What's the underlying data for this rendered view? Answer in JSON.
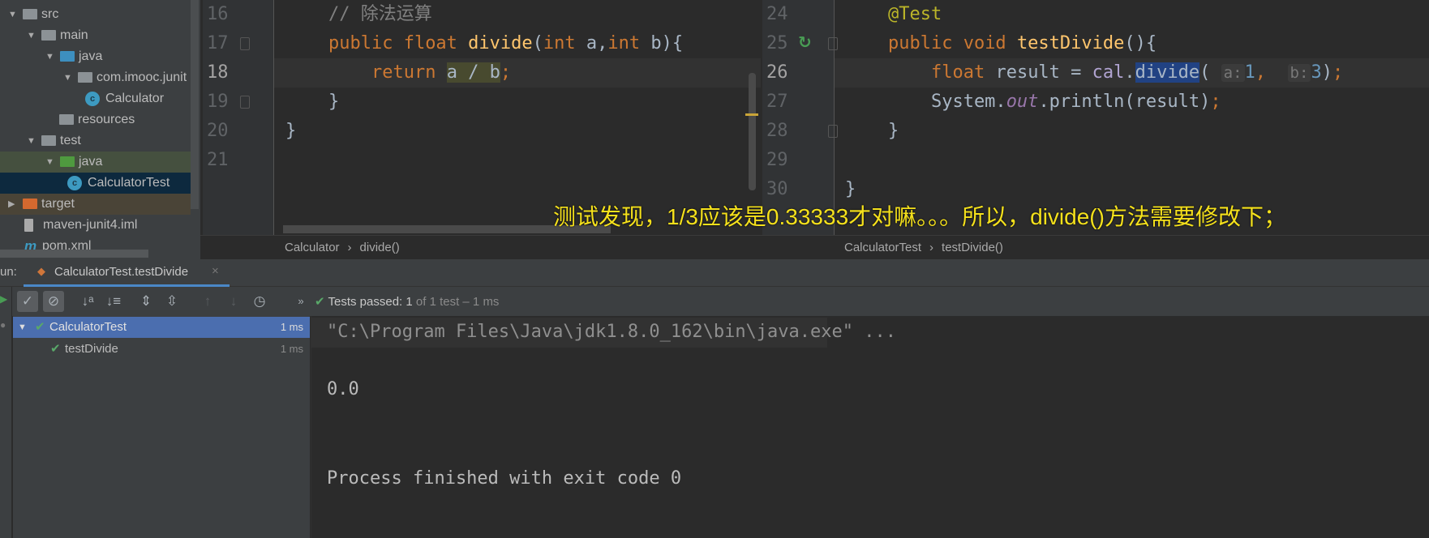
{
  "project_tree": {
    "items": [
      {
        "label": "src",
        "depth": 0,
        "expanded": true,
        "icon": "folder-icon"
      },
      {
        "label": "main",
        "depth": 1,
        "expanded": true,
        "icon": "folder-icon"
      },
      {
        "label": "java",
        "depth": 2,
        "expanded": true,
        "icon": "source-folder-icon"
      },
      {
        "label": "com.imooc.junit",
        "depth": 3,
        "expanded": true,
        "icon": "package-icon"
      },
      {
        "label": "Calculator",
        "depth": 4,
        "icon": "class-icon"
      },
      {
        "label": "resources",
        "depth": 2,
        "icon": "resources-folder-icon"
      },
      {
        "label": "test",
        "depth": 1,
        "expanded": true,
        "icon": "folder-icon"
      },
      {
        "label": "java",
        "depth": 2,
        "expanded": true,
        "icon": "test-folder-icon"
      },
      {
        "label": "CalculatorTest",
        "depth": 3,
        "icon": "test-class-icon",
        "selected": true
      },
      {
        "label": "target",
        "depth": 0,
        "expanded": false,
        "icon": "excluded-folder-icon"
      },
      {
        "label": "maven-junit4.iml",
        "depth": 0,
        "icon": "iml-file-icon"
      },
      {
        "label": "pom.xml",
        "depth": 0,
        "icon": "maven-icon"
      }
    ]
  },
  "left_editor": {
    "line_numbers": [
      "16",
      "17",
      "18",
      "19",
      "20",
      "21"
    ],
    "current_line": "18",
    "lines": [
      [
        {
          "c": "",
          "t": "    "
        },
        {
          "c": "cm",
          "t": "// 除法运算"
        }
      ],
      [
        {
          "c": "",
          "t": "    "
        },
        {
          "c": "kw",
          "t": "public float "
        },
        {
          "c": "fn",
          "t": "divide"
        },
        {
          "c": "",
          "t": "("
        },
        {
          "c": "kw",
          "t": "int "
        },
        {
          "c": "",
          "t": "a,"
        },
        {
          "c": "kw",
          "t": "int "
        },
        {
          "c": "",
          "t": "b){"
        }
      ],
      [
        {
          "c": "",
          "t": "        "
        },
        {
          "c": "kw",
          "t": "return "
        },
        {
          "c": "hl",
          "t": "a / b"
        },
        {
          "c": "kw",
          "t": ";"
        }
      ],
      [
        {
          "c": "",
          "t": "    }"
        }
      ],
      [
        {
          "c": "",
          "t": "}"
        }
      ],
      []
    ],
    "breadcrumb": [
      "Calculator",
      "divide()"
    ]
  },
  "right_editor": {
    "line_numbers": [
      "24",
      "25",
      "26",
      "27",
      "28",
      "29",
      "30"
    ],
    "current_line": "26",
    "lines": [
      [
        {
          "c": "",
          "t": "    "
        },
        {
          "c": "an",
          "t": "@Test"
        }
      ],
      [
        {
          "c": "",
          "t": "    "
        },
        {
          "c": "kw",
          "t": "public void "
        },
        {
          "c": "fn",
          "t": "testDivide"
        },
        {
          "c": "",
          "t": "(){"
        }
      ],
      [
        {
          "c": "",
          "t": "        "
        },
        {
          "c": "kw",
          "t": "float "
        },
        {
          "c": "",
          "t": "result = "
        },
        {
          "c": "var",
          "t": "cal"
        },
        {
          "c": "",
          "t": "."
        },
        {
          "c": "hlb",
          "t": "divide"
        },
        {
          "c": "",
          "t": "( "
        },
        {
          "c": "hint",
          "t": "a:"
        },
        {
          "c": "num",
          "t": "1"
        },
        {
          "c": "kw",
          "t": ", "
        },
        {
          "c": "",
          "t": " "
        },
        {
          "c": "hint",
          "t": "b:"
        },
        {
          "c": "num",
          "t": "3"
        },
        {
          "c": "",
          "t": ")"
        },
        {
          "c": "kw",
          "t": ";"
        }
      ],
      [
        {
          "c": "",
          "t": "        System."
        },
        {
          "c": "fld",
          "t": "out"
        },
        {
          "c": "",
          "t": ".println(result)"
        },
        {
          "c": "kw",
          "t": ";"
        }
      ],
      [
        {
          "c": "",
          "t": "    }"
        }
      ],
      [],
      [
        {
          "c": "",
          "t": "}"
        }
      ]
    ],
    "breadcrumb": [
      "CalculatorTest",
      "testDivide()"
    ]
  },
  "subtitle": "测试发现，1/3应该是0.33333才对嘛。。。所以，divide()方法需要修改下；",
  "run_panel": {
    "label": "un:",
    "tab_title": "CalculatorTest.testDivide",
    "status_prefix": "Tests passed:",
    "status_count": "1",
    "status_suffix": "of 1 test – 1 ms",
    "tests": [
      {
        "name": "CalculatorTest",
        "time": "1 ms",
        "selected": true
      },
      {
        "name": "testDivide",
        "time": "1 ms"
      }
    ],
    "console": [
      "\"C:\\Program Files\\Java\\jdk1.8.0_162\\bin\\java.exe\" ...",
      "0.0",
      "Process finished with exit code 0"
    ]
  },
  "colors": {
    "accent": "#4b6eaf",
    "pass": "#59a869",
    "subtitle": "#f5e11c"
  }
}
